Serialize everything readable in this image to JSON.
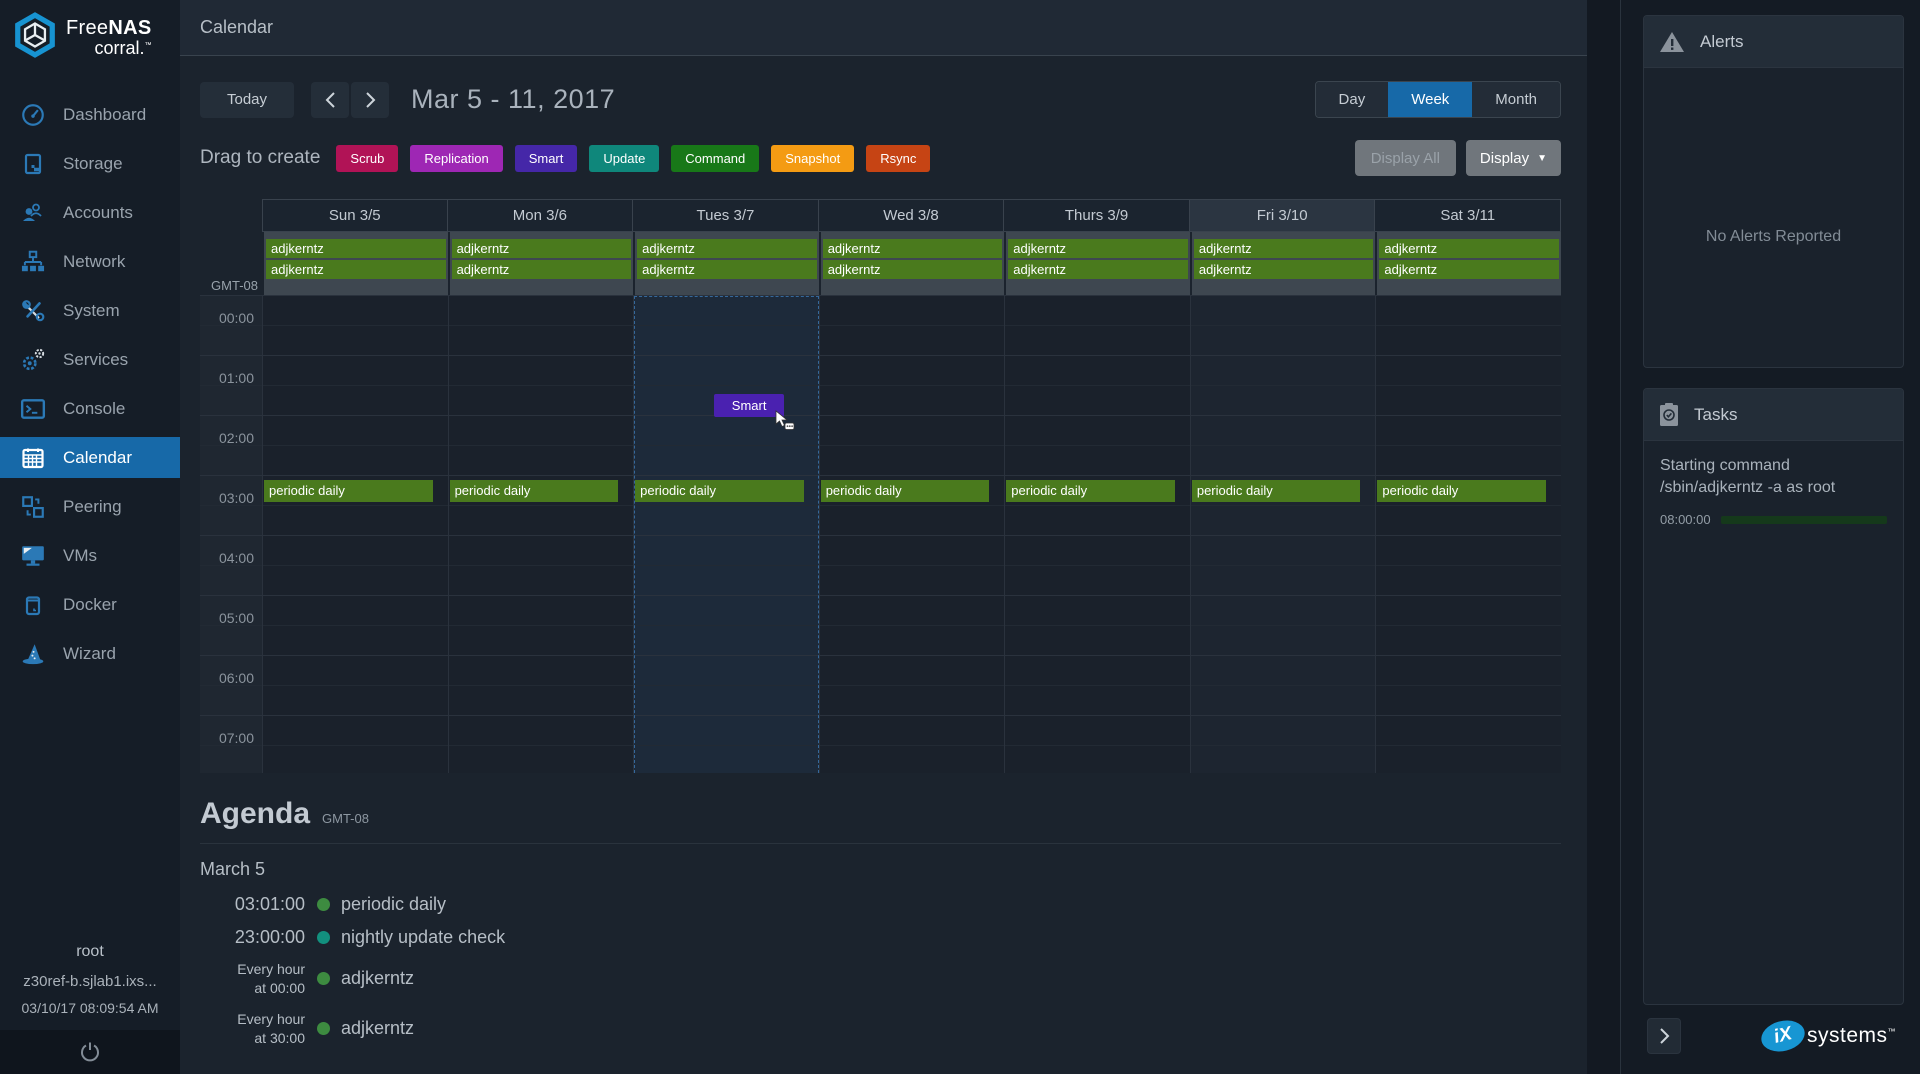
{
  "app": {
    "title": "Calendar"
  },
  "brand": {
    "free": "Free",
    "nas": "NAS",
    "sub": "corral.",
    "tm": "™"
  },
  "sidebar": {
    "items": [
      {
        "label": "Dashboard",
        "icon": "dashboard-icon"
      },
      {
        "label": "Storage",
        "icon": "storage-icon"
      },
      {
        "label": "Accounts",
        "icon": "accounts-icon"
      },
      {
        "label": "Network",
        "icon": "network-icon"
      },
      {
        "label": "System",
        "icon": "system-icon"
      },
      {
        "label": "Services",
        "icon": "services-icon"
      },
      {
        "label": "Console",
        "icon": "console-icon"
      },
      {
        "label": "Calendar",
        "icon": "calendar-icon",
        "active": true
      },
      {
        "label": "Peering",
        "icon": "peering-icon"
      },
      {
        "label": "VMs",
        "icon": "vms-icon"
      },
      {
        "label": "Docker",
        "icon": "docker-icon"
      },
      {
        "label": "Wizard",
        "icon": "wizard-icon"
      }
    ],
    "user": {
      "name": "root",
      "host": "z30ref-b.sjlab1.ixs...",
      "datetime": "03/10/17  08:09:54 AM"
    }
  },
  "toolbar": {
    "today": "Today",
    "range": "Mar 5 - 11, 2017",
    "views": [
      "Day",
      "Week",
      "Month"
    ],
    "active_view": "Week"
  },
  "drag_bar": {
    "label": "Drag to create",
    "chips": [
      {
        "label": "Scrub",
        "color": "#b11356"
      },
      {
        "label": "Replication",
        "color": "#9e27b4"
      },
      {
        "label": "Smart",
        "color": "#4527a8"
      },
      {
        "label": "Update",
        "color": "#0f877b"
      },
      {
        "label": "Command",
        "color": "#187818"
      },
      {
        "label": "Snapshot",
        "color": "#f49b13"
      },
      {
        "label": "Rsync",
        "color": "#c64414"
      }
    ],
    "display_all": "Display All",
    "display": "Display"
  },
  "calendar": {
    "timezone": "GMT-08",
    "days": [
      {
        "label": "Sun 3/5"
      },
      {
        "label": "Mon 3/6"
      },
      {
        "label": "Tues 3/7"
      },
      {
        "label": "Wed 3/8"
      },
      {
        "label": "Thurs 3/9"
      },
      {
        "label": "Fri 3/10"
      },
      {
        "label": "Sat 3/11"
      }
    ],
    "today_label": "Fri 3/10",
    "selected_label": "Tues 3/7",
    "hours": [
      "00:00",
      "01:00",
      "02:00",
      "03:00",
      "04:00",
      "05:00",
      "06:00",
      "07:00"
    ],
    "allday_event": "adjkerntz",
    "periodic_event": "periodic daily",
    "drag_event": {
      "label": "Smart",
      "day": "Tues 3/7",
      "color": "#4a21b0"
    },
    "event_green": "#4a7a1d"
  },
  "agenda": {
    "title": "Agenda",
    "timezone": "GMT-08",
    "date": "March 5",
    "rows": [
      {
        "time": "03:01:00",
        "dot_color": "#3d8b40",
        "label": "periodic daily"
      },
      {
        "time": "23:00:00",
        "dot_color": "#12907e",
        "label": "nightly update check"
      },
      {
        "time_line1": "Every hour",
        "time_line2": "at 00:00",
        "dot_color": "#3d8b40",
        "label": "adjkerntz"
      },
      {
        "time_line1": "Every hour",
        "time_line2": "at 30:00",
        "dot_color": "#3d8b40",
        "label": "adjkerntz"
      }
    ]
  },
  "alerts": {
    "title": "Alerts",
    "empty": "No Alerts Reported"
  },
  "tasks": {
    "title": "Tasks",
    "task_line1": "Starting command",
    "task_line2": "/sbin/adjkerntz -a as root",
    "time": "08:00:00",
    "progress_pct": 100,
    "progress_color": "#23a127"
  }
}
